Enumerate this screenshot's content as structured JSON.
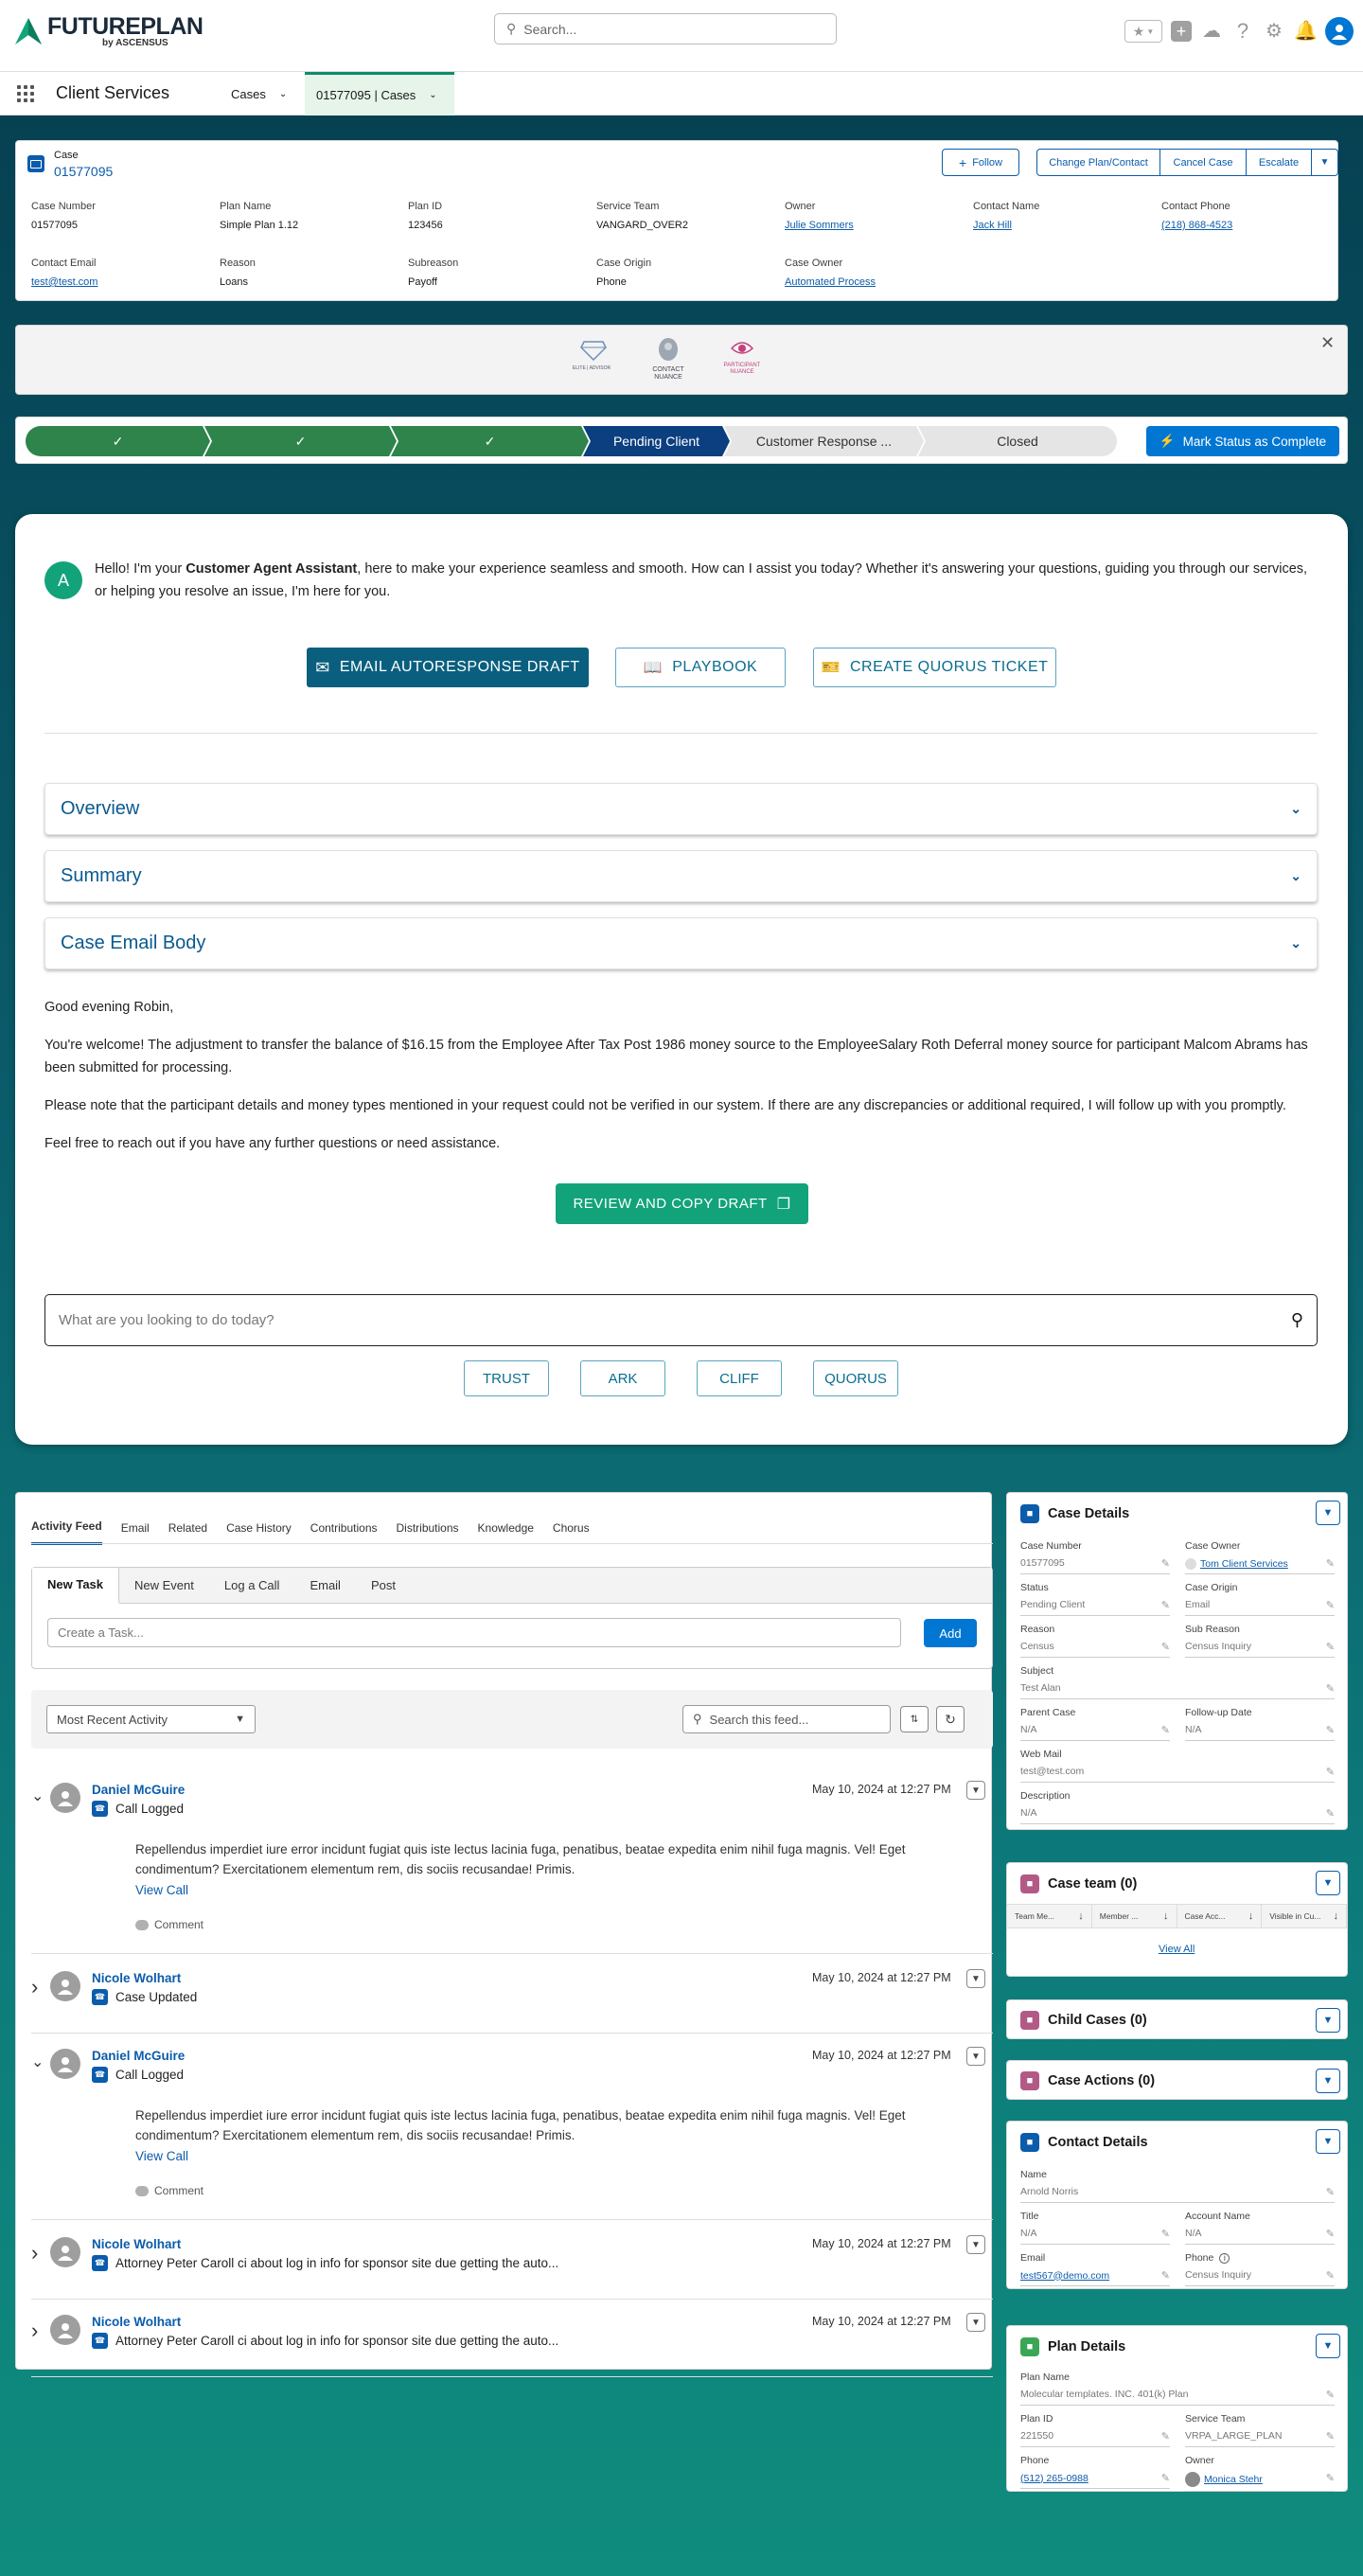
{
  "header": {
    "logo": "FUTUREPLAN",
    "logo_sub": "by ASCENSUS",
    "search_placeholder": "Search...",
    "icons": [
      "favorites-icon",
      "add-icon",
      "cloud-icon",
      "help-icon",
      "gear-icon",
      "bell-icon",
      "user-avatar-icon"
    ]
  },
  "nav": {
    "app_name": "Client Services",
    "tab_cases": "Cases",
    "tab_record": "01577095 | Cases"
  },
  "case": {
    "label": "Case",
    "number": "01577095",
    "buttons": {
      "follow": "Follow",
      "change": "Change Plan/Contact",
      "cancel": "Cancel Case",
      "escalate": "Escalate"
    },
    "fields": [
      {
        "label": "Case Number",
        "value": "01577095",
        "link": false
      },
      {
        "label": "Plan Name",
        "value": "Simple Plan 1.12",
        "link": false
      },
      {
        "label": "Plan ID",
        "value": "123456",
        "link": false
      },
      {
        "label": "Service Team",
        "value": "VANGARD_OVER2",
        "link": false
      },
      {
        "label": "Owner",
        "value": "Julie Sommers",
        "link": true
      },
      {
        "label": "Contact Name",
        "value": "Jack Hill",
        "link": true
      },
      {
        "label": "Contact Phone",
        "value": "(218) 868-4523",
        "link": true
      },
      {
        "label": "Contact Email",
        "value": "test@test.com",
        "link": true
      },
      {
        "label": "Reason",
        "value": "Loans",
        "link": false
      },
      {
        "label": "Subreason",
        "value": "Payoff",
        "link": false
      },
      {
        "label": "Case Origin",
        "value": "Phone",
        "link": false
      },
      {
        "label": "Case Owner",
        "value": "Automated Process",
        "link": true
      }
    ]
  },
  "badges": [
    {
      "label": "ELITE | ADVISOR"
    },
    {
      "label": "CONTACT NUANCE"
    },
    {
      "label": "PARTICIPANT NUANCE"
    }
  ],
  "path": {
    "steps": [
      "",
      "",
      "",
      "Pending Client",
      "Customer Response ...",
      "Closed"
    ],
    "button": "Mark Status as Complete"
  },
  "assistant": {
    "avatar": "A",
    "greeting_pre": "Hello! I'm your ",
    "greeting_bold": "Customer Agent Assistant",
    "greeting_post": ", here to make your experience seamless and smooth. How can I assist you today? Whether it's answering your questions, guiding you through our services, or helping you resolve an issue, I'm here for you.",
    "actions": [
      "EMAIL AUTORESPONSE DRAFT",
      "PLAYBOOK",
      "CREATE QUORUS TICKET"
    ],
    "sections": [
      "Overview",
      "Summary",
      "Case Email Body"
    ],
    "email": [
      "Good evening Robin,",
      "You're welcome! The adjustment to transfer the balance of $16.15 from the Employee After Tax Post 1986 money source to the EmployeeSalary Roth Deferral money source for participant Malcom Abrams has been submitted for processing.",
      "Please note that the participant details and money types mentioned in your request could not be verified in our system. If there are any discrepancies or additional required, I will follow up with you promptly.",
      "Feel free to reach out if you have any further questions or need assistance."
    ],
    "copy_button": "REVIEW AND COPY DRAFT",
    "prompt_placeholder": "What are you looking to do today?",
    "quick": [
      "TRUST",
      "ARK",
      "CLIFF",
      "QUORUS"
    ]
  },
  "feed": {
    "tabs": [
      "Activity Feed",
      "Email",
      "Related",
      "Case History",
      "Contributions",
      "Distributions",
      "Knowledge",
      "Chorus"
    ],
    "publisher_tabs": [
      "New Task",
      "New Event",
      "Log a Call",
      "Email",
      "Post"
    ],
    "task_placeholder": "Create a Task...",
    "add": "Add",
    "filter": "Most Recent Activity",
    "search_placeholder": "Search this feed...",
    "items": [
      {
        "name": "Daniel McGuire",
        "date": "May 10, 2024 at 12:27 PM",
        "action": "Call Logged",
        "expanded": true,
        "body": "Repellendus imperdiet iure error incidunt fugiat quis iste lectus lacinia fuga, penatibus, beatae expedita enim nihil fuga magnis. Vel! Eget condimentum? Exercitationem elementum rem, dis sociis recusandae! Primis.",
        "link": "View Call",
        "comment": "Comment"
      },
      {
        "name": "Nicole Wolhart",
        "date": "May 10, 2024 at 12:27 PM",
        "action": "Case Updated",
        "expanded": false
      },
      {
        "name": "Daniel McGuire",
        "date": "May 10, 2024 at 12:27 PM",
        "action": "Call Logged",
        "expanded": true,
        "body": "Repellendus imperdiet iure error incidunt fugiat quis iste lectus lacinia fuga, penatibus, beatae expedita enim nihil fuga magnis. Vel! Eget condimentum? Exercitationem elementum rem, dis sociis recusandae! Primis.",
        "link": "View Call",
        "comment": "Comment"
      },
      {
        "name": "Nicole Wolhart",
        "date": "May 10, 2024 at 12:27 PM",
        "action": "Attorney Peter Caroll ci about log in info for sponsor site due getting the auto...",
        "expanded": false
      },
      {
        "name": "Nicole Wolhart",
        "date": "May 10, 2024 at 12:27 PM",
        "action": "Attorney Peter Caroll ci about log in info for sponsor site due getting the auto...",
        "expanded": false
      }
    ]
  },
  "side": {
    "case_details": {
      "title": "Case Details",
      "fields": [
        {
          "label": "Case Number",
          "value": "01577095"
        },
        {
          "label": "Case Owner",
          "value": "Tom Client Services",
          "link": true
        },
        {
          "label": "Status",
          "value": "Pending Client"
        },
        {
          "label": "Case Origin",
          "value": "Email"
        },
        {
          "label": "Reason",
          "value": "Census"
        },
        {
          "label": "Sub Reason",
          "value": "Census Inquiry"
        },
        {
          "label": "Subject",
          "value": "Test Alan"
        },
        {
          "label": "Parent Case",
          "value": "N/A"
        },
        {
          "label": "Follow-up Date",
          "value": "N/A"
        },
        {
          "label": "Web Mail",
          "value": "test@test.com"
        },
        {
          "label": "Description",
          "value": "N/A"
        }
      ]
    },
    "case_team": {
      "title": "Case team (0)",
      "cols": [
        "Team Me...",
        "Member ...",
        "Case Acc...",
        "Visible in Cu..."
      ],
      "view_all": "View All"
    },
    "child_cases": {
      "title": "Child Cases (0)"
    },
    "case_actions": {
      "title": "Case Actions (0)"
    },
    "contact": {
      "title": "Contact Details",
      "fields": [
        {
          "label": "Name",
          "value": "Arnold Norris"
        },
        {
          "label": "Title",
          "value": "N/A"
        },
        {
          "label": "Account Name",
          "value": "N/A"
        },
        {
          "label": "Email",
          "value": "test567@demo.com",
          "link": true
        },
        {
          "label": "Phone",
          "value": "Census Inquiry"
        }
      ]
    },
    "plan": {
      "title": "Plan Details",
      "fields": [
        {
          "label": "Plan Name",
          "value": "Molecular templates. INC. 401(k) Plan"
        },
        {
          "label": "Plan ID",
          "value": "221550"
        },
        {
          "label": "Service Team",
          "value": "VRPA_LARGE_PLAN"
        },
        {
          "label": "Phone",
          "value": "(512) 265-0988",
          "link": true
        },
        {
          "label": "Owner",
          "value": "Monica Stehr",
          "link": true
        }
      ]
    }
  }
}
